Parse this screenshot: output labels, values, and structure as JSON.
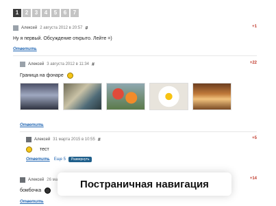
{
  "pager": {
    "pages": [
      "1",
      "2",
      "3",
      "4",
      "5",
      "6",
      "7"
    ],
    "active": "1"
  },
  "comments": [
    {
      "author": "Алексей",
      "date": "2 августа 2012 в 20:57",
      "hash": "#",
      "score": "+1",
      "text": "Ну я первый. Обсуждение открыто. Лейте =)",
      "reply": "Ответить"
    },
    {
      "author": "Алексей",
      "date": "3 августа 2012 в 11:34",
      "hash": "#",
      "score": "+22",
      "text": "Граница на фонаре",
      "reply": "Ответить"
    },
    {
      "author": "Алексей",
      "date": "31 марта 2015 в 10:55",
      "hash": "#",
      "score": "+5",
      "text": "тест",
      "reply": "Ответить",
      "more": "Еще 5",
      "expand": "Развернуть"
    },
    {
      "author": "Алексей",
      "date": "26 ма",
      "score": "+14",
      "text": "бомбочка",
      "reply": "Ответить"
    }
  ],
  "toast": {
    "text": "Постраничная навигация"
  },
  "colors": {
    "accent": "#2166b3",
    "score": "#c0392b",
    "button": "#1f5f8b"
  }
}
